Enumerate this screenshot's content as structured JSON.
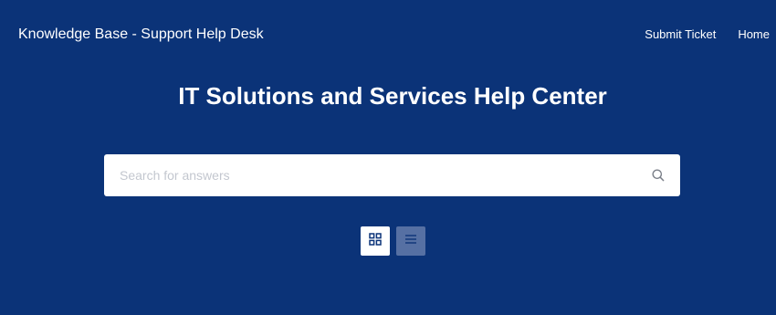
{
  "header": {
    "site_title": "Knowledge Base - Support Help Desk",
    "nav": {
      "submit_ticket": "Submit Ticket",
      "home": "Home"
    }
  },
  "hero": {
    "title": "IT Solutions and Services Help Center"
  },
  "search": {
    "placeholder": "Search for answers",
    "value": "",
    "icon": "search-icon"
  },
  "view_toggle": {
    "selected": "grid",
    "options": [
      "grid",
      "list"
    ],
    "grid_icon": "grid-view-icon",
    "list_icon": "list-view-icon"
  },
  "colors": {
    "background": "#0b3378",
    "accent": "#0b3378",
    "inactive_toggle": "#5670a3",
    "text": "#ffffff",
    "placeholder": "#c3c7cf"
  }
}
